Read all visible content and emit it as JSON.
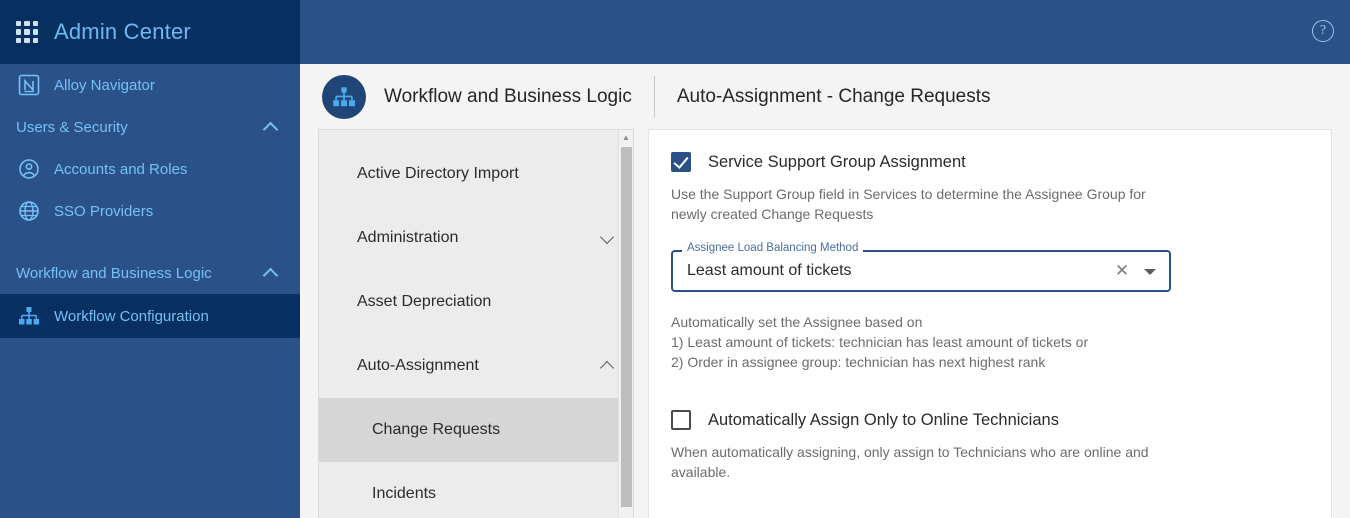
{
  "topbar": {
    "app_title": "Admin Center",
    "grid_icon": "apps-grid-icon",
    "help_icon": "?"
  },
  "sidebar": {
    "product": {
      "label": "Alloy Navigator",
      "icon": "navigator-logo-icon"
    },
    "sections": [
      {
        "label": "Users & Security",
        "expanded": true,
        "items": [
          {
            "label": "Accounts and Roles",
            "icon": "user-circle-icon",
            "active": false
          },
          {
            "label": "SSO Providers",
            "icon": "globe-icon",
            "active": false
          }
        ]
      },
      {
        "label": "Workflow and Business Logic",
        "expanded": true,
        "items": [
          {
            "label": "Workflow Configuration",
            "icon": "org-chart-icon",
            "active": true
          }
        ]
      }
    ]
  },
  "pagehead": {
    "icon": "org-chart-icon",
    "title": "Workflow and Business Logic",
    "subtitle": "Auto-Assignment - Change Requests"
  },
  "midpanel": {
    "items": [
      {
        "label": "Active Directory Import",
        "type": "leaf",
        "selected": false
      },
      {
        "label": "Administration",
        "type": "group",
        "expanded": false,
        "selected": false
      },
      {
        "label": "Asset Depreciation",
        "type": "leaf",
        "selected": false
      },
      {
        "label": "Auto-Assignment",
        "type": "group",
        "expanded": true,
        "selected": false
      },
      {
        "label": "Change Requests",
        "type": "child",
        "selected": true
      },
      {
        "label": "Incidents",
        "type": "child",
        "selected": false
      }
    ],
    "scrollbar": {
      "up_arrow": "▲"
    }
  },
  "content": {
    "support_group": {
      "checkbox_label": "Service Support Group Assignment",
      "checked": true,
      "description": "Use the Support Group field in Services to determine the Assignee Group for newly created Change Requests"
    },
    "balancing_field": {
      "legend": "Assignee Load Balancing Method",
      "value": "Least amount of tickets",
      "clear_icon": "✕",
      "dropdown_icon": "chevron-down-icon"
    },
    "balancing_help": [
      "Automatically set the Assignee based on",
      "1) Least amount of tickets: technician has least amount of tickets or",
      "2) Order in assignee group: technician has next highest rank"
    ],
    "online_only": {
      "checkbox_label": "Automatically Assign Only to Online Technicians",
      "checked": false,
      "description": "When automatically assigning, only assign to Technicians who are online and available."
    }
  },
  "colors": {
    "header_dark": "#072f5f",
    "sidebar_blue": "#2b5288",
    "accent_light": "#74c0f7",
    "field_border": "#2b5288"
  }
}
